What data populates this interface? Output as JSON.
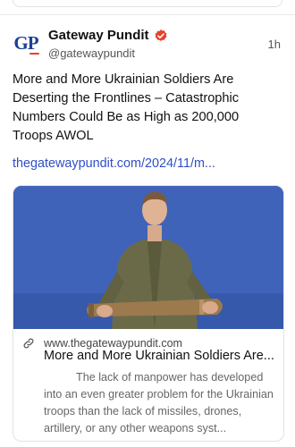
{
  "post": {
    "author_name": "Gateway Pundit",
    "author_handle": "@gatewaypundit",
    "avatar_text": "GP",
    "timestamp": "1h",
    "text": "More and More Ukrainian Soldiers Are Deserting the Frontlines – Catastrophic Numbers Could Be as High as 200,000 Troops AWOL",
    "link_text": "thegatewaypundit.com/2024/11/m..."
  },
  "link_card": {
    "domain": "www.thegatewaypundit.com",
    "title": "More and More Ukrainian Soldiers Are...",
    "description": "The lack of manpower has developed into an even greater problem for the Ukrainian troops than the lack of missiles, drones, artillery, or any other weapons syst..."
  },
  "icons": {
    "verified": "verified-badge-icon",
    "link": "link-icon"
  },
  "colors": {
    "verified_badge": "#e8402a",
    "link": "#2f4fc7",
    "image_background": "#3f63b8"
  }
}
